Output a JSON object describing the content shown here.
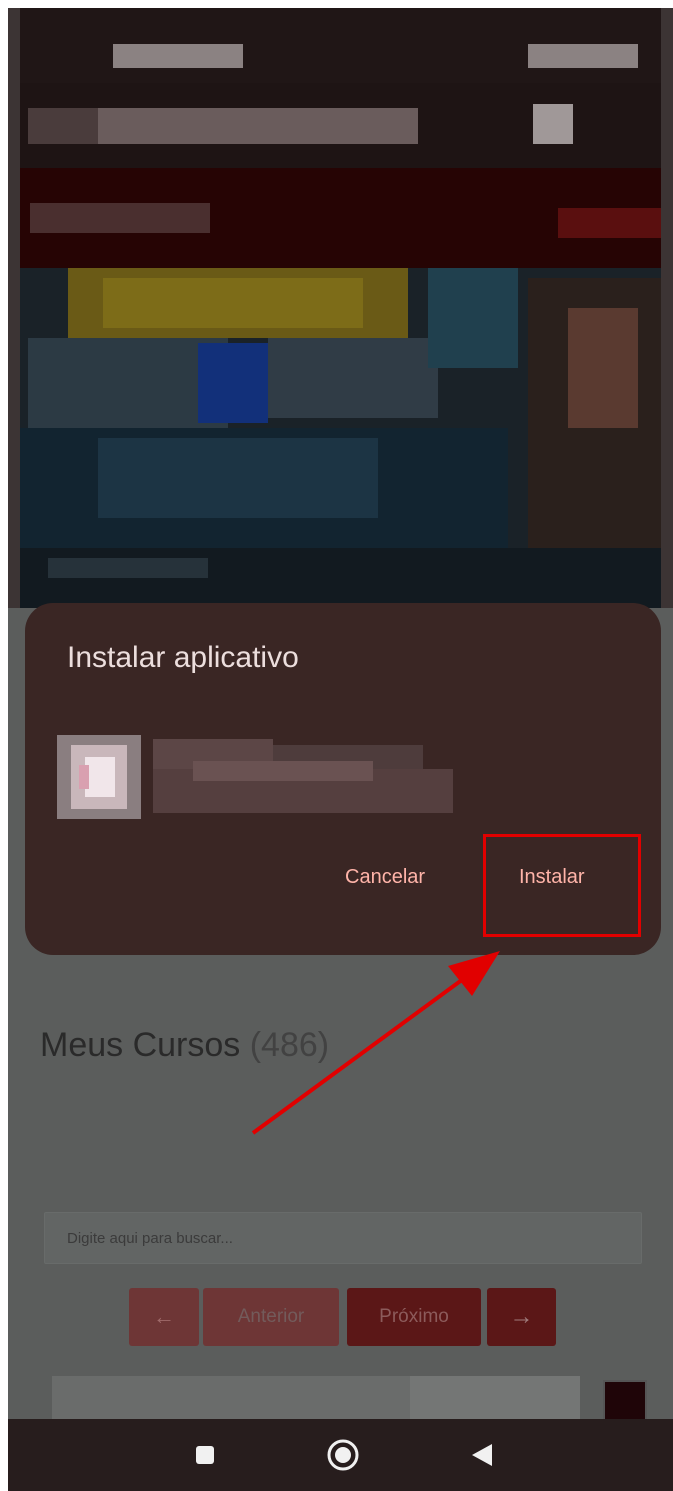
{
  "dialog": {
    "title": "Instalar aplicativo",
    "cancel_label": "Cancelar",
    "install_label": "Instalar"
  },
  "page": {
    "courses_title": "Meus Cursos",
    "courses_count": "(486)",
    "search_placeholder": "Digite aqui para buscar...",
    "pager": {
      "prev_arrow": "←",
      "prev_label": "Anterior",
      "next_label": "Próximo",
      "next_arrow": "→"
    }
  },
  "annotation": {
    "highlight_color": "#e10000"
  },
  "navbar": {
    "icons": [
      "recents-square-icon",
      "home-circle-icon",
      "back-triangle-icon"
    ]
  }
}
